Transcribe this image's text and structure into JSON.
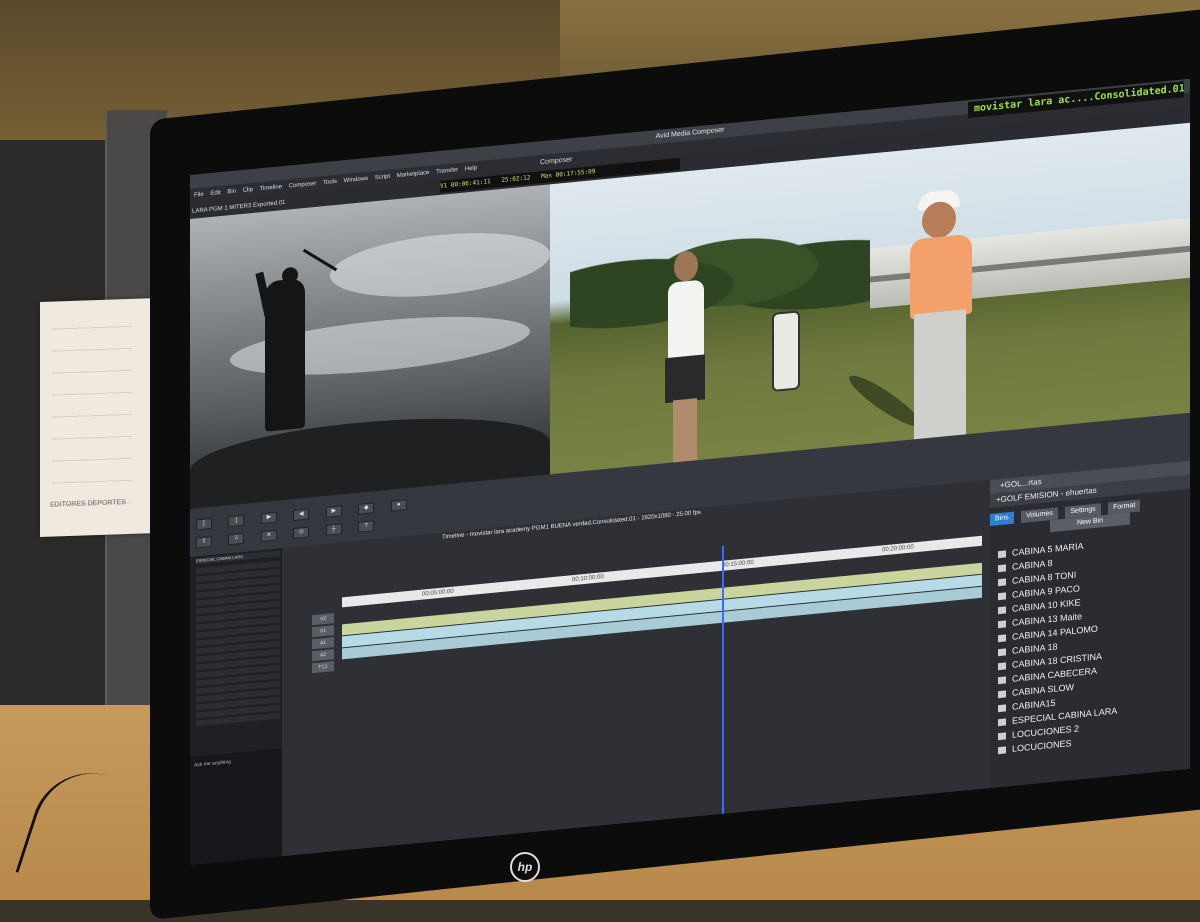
{
  "app": {
    "window_title": "Avid Media Composer",
    "composer_label": "Composer",
    "menu": [
      "File",
      "Edit",
      "Bin",
      "Clip",
      "Timeline",
      "Composer",
      "Tools",
      "Windows",
      "Script",
      "Marketplace",
      "Transfer",
      "Help"
    ]
  },
  "monitors": {
    "source_clip_name": "LARA PGM 1 MITER3 Exported.01",
    "timecode_left": "V1     00:06:41:11",
    "timecode_mid": "25:02:12",
    "timecode_right": "Mas    00:17:55:09",
    "record_bin_title": "movistar lara ac....Consolidated.01"
  },
  "timeline": {
    "title": "Timeline - movistar lara academy PGM1 BUENA verdad.Consolidated.01 - 1920x1080 - 25.00 fps",
    "ruler_labels": [
      "00:05:00:00",
      "00:10:00:00",
      "00:15:00:00",
      "00:20:00:00"
    ],
    "tracks": [
      "V2",
      "V1",
      "A1",
      "A2",
      "TC1"
    ]
  },
  "bins_panel": {
    "title": "+GOL...rtas",
    "subtitle": "+GOLF EMISION - ehuertas",
    "tabs": [
      "Bins",
      "Volumes",
      "Settings",
      "Format"
    ],
    "new_bin_label": "New Bin",
    "items": [
      "CABINA 5 MARIA",
      "CABINA 8",
      "CABINA 8 TONI",
      "CABINA 9 PACO",
      "CABINA 10 KIKE",
      "CABINA 13 Maite",
      "CABINA 14 PALOMO",
      "CABINA 18",
      "CABINA 18 CRISTINA",
      "CABINA CABECERA",
      "CABINA SLOW",
      "CABINA15",
      "ESPECIAL CABINA LARA",
      "LOCUCIONES 2",
      "LOCUCIONES"
    ]
  },
  "left_bin": {
    "header": "ESPECIAL CABINA LARA",
    "taskbar_search": "Ask me anything"
  },
  "paper_note": {
    "label": "EDITORES DEPORTES"
  },
  "monitor_brand": "hp",
  "colors": {
    "timecode_green": "#9ce63a",
    "playhead": "#3d6bff",
    "video_track": "#c9d59c",
    "audio_track": "#b7dbe6"
  }
}
